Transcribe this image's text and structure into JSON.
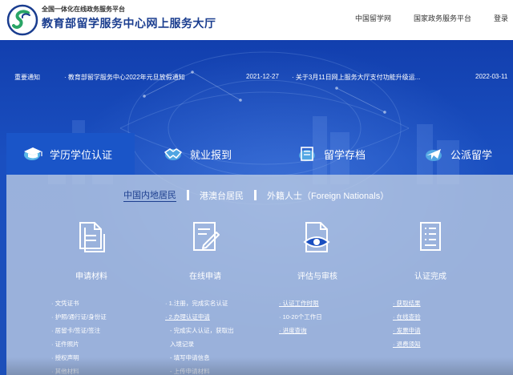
{
  "header": {
    "platform_tagline": "全国一体化在线政务服务平台",
    "site_title": "教育部留学服务中心网上服务大厅",
    "nav": [
      {
        "label": "中国留学网"
      },
      {
        "label": "国家政务服务平台"
      },
      {
        "label": "登录"
      }
    ]
  },
  "notice": {
    "label": "重要通知",
    "items": [
      {
        "text": "· 教育部留学服务中心2022年元旦放假通知",
        "date": "2021-12-27"
      },
      {
        "text": "· 关于3月11日网上服务大厅支付功能升级运...",
        "date": "2022-03-11"
      }
    ]
  },
  "tabs": [
    {
      "label": "学历学位认证",
      "icon": "graduation-cap-icon",
      "active": true
    },
    {
      "label": "就业报到",
      "icon": "handshake-icon",
      "active": false
    },
    {
      "label": "留学存档",
      "icon": "archive-box-icon",
      "active": false
    },
    {
      "label": "公派留学",
      "icon": "airplane-icon",
      "active": false
    }
  ],
  "categories": [
    {
      "label": "中国内地居民",
      "active": true
    },
    {
      "label": "港澳台居民",
      "active": false
    },
    {
      "label": "外籍人士（Foreign Nationals）",
      "active": false
    }
  ],
  "steps": [
    {
      "label": "申请材料",
      "icon": "documents-icon"
    },
    {
      "label": "在线申请",
      "icon": "edit-form-icon"
    },
    {
      "label": "评估与审核",
      "icon": "review-eye-icon"
    },
    {
      "label": "认证完成",
      "icon": "completed-doc-icon"
    }
  ],
  "columns": [
    {
      "items": [
        {
          "text": "· 文凭证书",
          "sub": false
        },
        {
          "text": "· 护照/通行证/身份证",
          "sub": false
        },
        {
          "text": "· 居留卡/签证/签注",
          "sub": false
        },
        {
          "text": "· 证件照片",
          "sub": false
        },
        {
          "text": "· 授权声明",
          "sub": false
        },
        {
          "text": "· 其他材料",
          "sub": false
        }
      ]
    },
    {
      "items": [
        {
          "text": "· 1.注册，完成实名认证",
          "sub": false
        },
        {
          "text": "· 2.办理认证申请",
          "sub": false
        },
        {
          "text": "- 完成实人认证，获取出",
          "sub": true
        },
        {
          "text": "入境记录",
          "sub": true
        },
        {
          "text": "- 填写申请信息",
          "sub": true
        },
        {
          "text": "- 上传申请材料",
          "sub": true
        }
      ]
    },
    {
      "items": [
        {
          "text": "· 认证工作时限",
          "sub": false
        },
        {
          "text": "· 10-20个工作日",
          "sub": false
        },
        {
          "text": "· 进度查询",
          "sub": false
        }
      ]
    },
    {
      "items": [
        {
          "text": "· 获取结果",
          "sub": false
        },
        {
          "text": "· 在线查验",
          "sub": false
        },
        {
          "text": "· 发票申请",
          "sub": false
        },
        {
          "text": "· 退费须知",
          "sub": false
        }
      ]
    }
  ],
  "colors": {
    "brand_blue": "#1a3d8f",
    "hero_blue": "#1a4fc0",
    "active_tab": "#1a55c8",
    "logo_green": "#2aa566"
  }
}
